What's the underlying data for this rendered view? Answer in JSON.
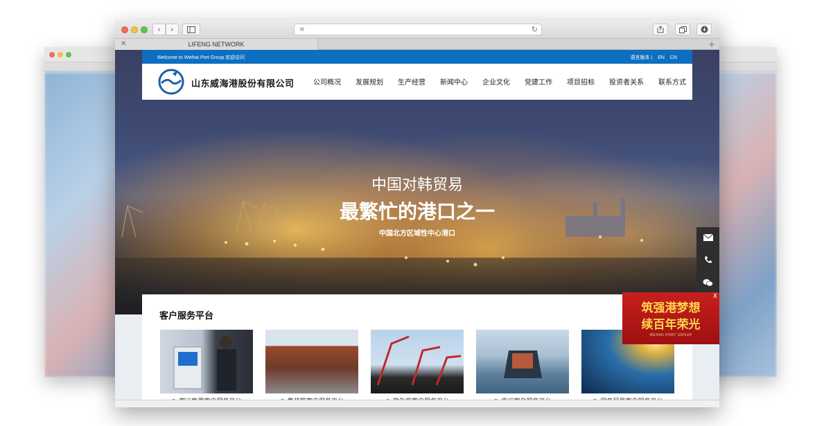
{
  "browser": {
    "tab_title": "LIFENG NETWORK",
    "tab_close": "✕",
    "tab_plus": "+",
    "back": "‹",
    "forward": "›",
    "reload": "↻"
  },
  "site": {
    "welcome": "Welcome to Weihai Port Group 欢迎访问",
    "lang_label": "语言版本 |",
    "lang_en": "EN",
    "lang_cn": "CN",
    "company_name": "山东威海港股份有限公司",
    "nav": [
      "公司概况",
      "发展规划",
      "生产经营",
      "新闻中心",
      "企业文化",
      "党建工作",
      "项目招标",
      "投资者关系",
      "联系方式"
    ]
  },
  "hero": {
    "line1": "中国对韩贸易",
    "line2": "最繁忙的港口之一",
    "line3": "中国北方区域性中心港口"
  },
  "services": {
    "title": "客户服务平台",
    "items": [
      {
        "label": "客运售票客户服务平台"
      },
      {
        "label": "集装箱客户服务平台"
      },
      {
        "label": "散杂货客户服务平台"
      },
      {
        "label": "货代客户服务平台"
      },
      {
        "label": "服务贸易客户服务平台"
      }
    ]
  },
  "promo": {
    "line1": "筑强港梦想",
    "line2": "续百年荣光",
    "line3": "WEIHAI PORT GROUP",
    "close": "X"
  },
  "contact_icons": [
    "mail-icon",
    "phone-icon",
    "wechat-icon"
  ],
  "colors": {
    "top_bar": "#0d6fc0",
    "promo_red": "#c8201d",
    "promo_gold": "#ffd54a"
  }
}
